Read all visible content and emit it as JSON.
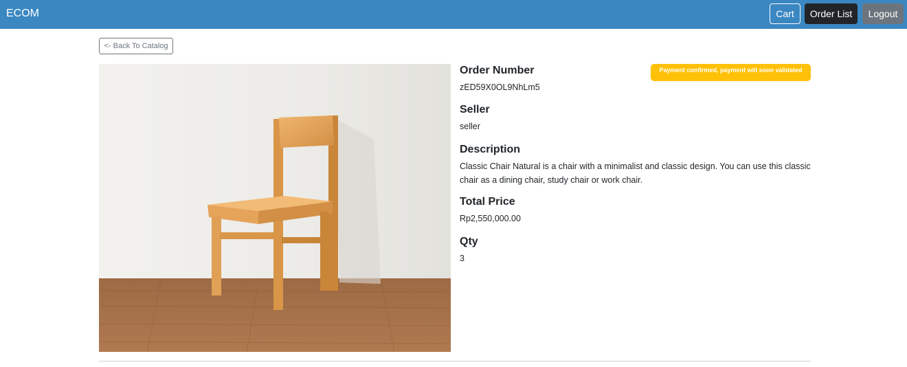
{
  "navbar": {
    "brand": "ECOM",
    "cart_label": "Cart",
    "order_list_label": "Order List",
    "logout_label": "Logout"
  },
  "back_button_label": "<- Back To Catalog",
  "order": {
    "status_badge": "Payment confirmed, payment will soon validated",
    "status_color": "#ffc107",
    "order_number_title": "Order Number",
    "order_number": "zED59X0OL9NhLm5",
    "seller_title": "Seller",
    "seller": "seller",
    "description_title": "Description",
    "description": "Classic Chair Natural is a chair with a minimalist and classic design. You can use this classic chair as a dining chair, study chair or work chair.",
    "total_price_title": "Total Price",
    "total_price": "Rp2,550,000.00",
    "qty_title": "Qty",
    "qty": "3"
  },
  "colors": {
    "navbar": "#3a87c2",
    "order_list_button": "#212529",
    "logout_button": "#6c757d"
  },
  "image": {
    "subject": "wooden-chair-photo"
  }
}
